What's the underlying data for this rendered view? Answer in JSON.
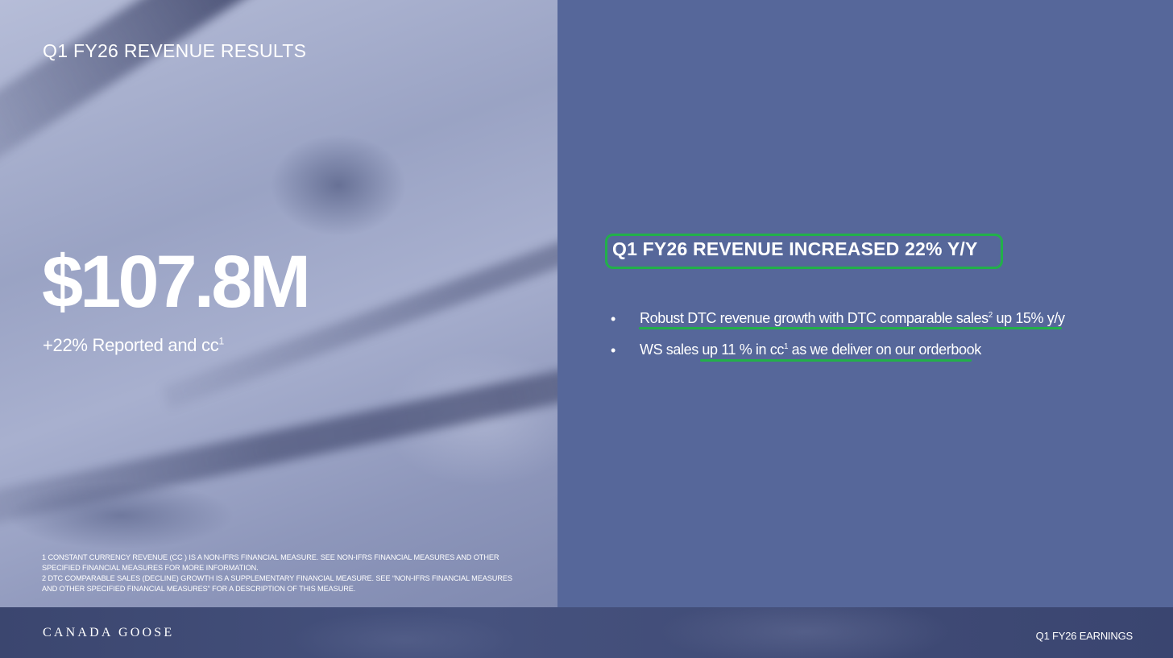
{
  "slide": {
    "title": "Q1 FY26 REVENUE RESULTS",
    "big_number": "$107.8M",
    "growth_text": "+22% Reported and cc",
    "growth_sup": "1"
  },
  "footnotes": [
    "1 CONSTANT CURRENCY REVENUE (CC ) IS A NON-IFRS FINANCIAL MEASURE. SEE NON-IFRS FINANCIAL MEASURES AND OTHER SPECIFIED FINANCIAL MEASURES FOR MORE INFORMATION.",
    "2 DTC COMPARABLE SALES (DECLINE) GROWTH IS A SUPPLEMENTARY FINANCIAL MEASURE. SEE “NON-IFRS FINANCIAL MEASURES AND OTHER SPECIFIED FINANCIAL MEASURES” FOR A DESCRIPTION OF THIS MEASURE."
  ],
  "highlights": {
    "heading": "Q1 FY26 REVENUE INCREASED 22% Y/Y",
    "bullet_symbol": "•",
    "bullets": [
      {
        "text_before": "Robust DTC revenue growth with DTC comparable sales",
        "sup": "2",
        "text_after": " up 15% y/y"
      },
      {
        "text_before": "WS sales up 11 % in cc",
        "sup": "1",
        "text_after": " as we deliver on our orderbook"
      }
    ],
    "highlight_color": "#22b04a"
  },
  "footer": {
    "brand": "CANADA GOOSE",
    "label": "Q1 FY26 EARNINGS"
  }
}
